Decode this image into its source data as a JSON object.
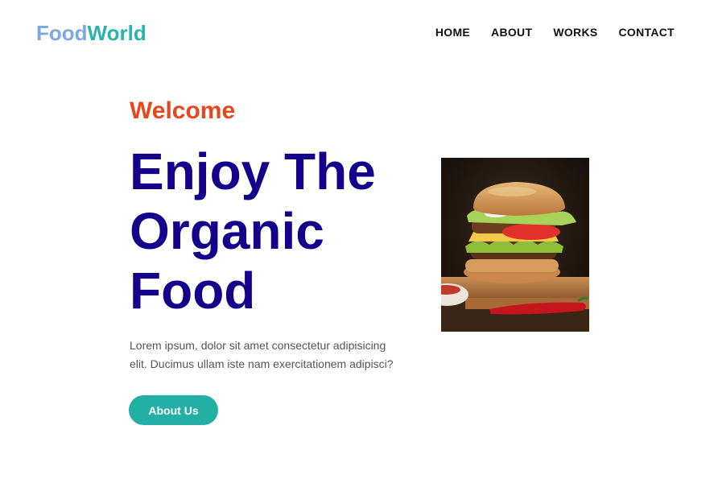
{
  "logo": {
    "part1": "Food",
    "part2": "World"
  },
  "nav": {
    "items": [
      {
        "label": "HOME"
      },
      {
        "label": "ABOUT"
      },
      {
        "label": "WORKS"
      },
      {
        "label": "CONTACT"
      }
    ]
  },
  "hero": {
    "welcome": "Welcome",
    "headline": [
      "Enjoy The",
      "Organic",
      "Food"
    ],
    "description_lines": [
      "Lorem ipsum, dolor sit amet consectetur adipisicing",
      "elit. Ducimus ullam iste nam exercitationem adipisci?"
    ],
    "button_label": "About Us"
  },
  "colors": {
    "logo_food": "#7fa7e3",
    "logo_world": "#2bb3ad",
    "welcome": "#e8461c",
    "headline": "#14008a",
    "button": "#22b0a6"
  }
}
